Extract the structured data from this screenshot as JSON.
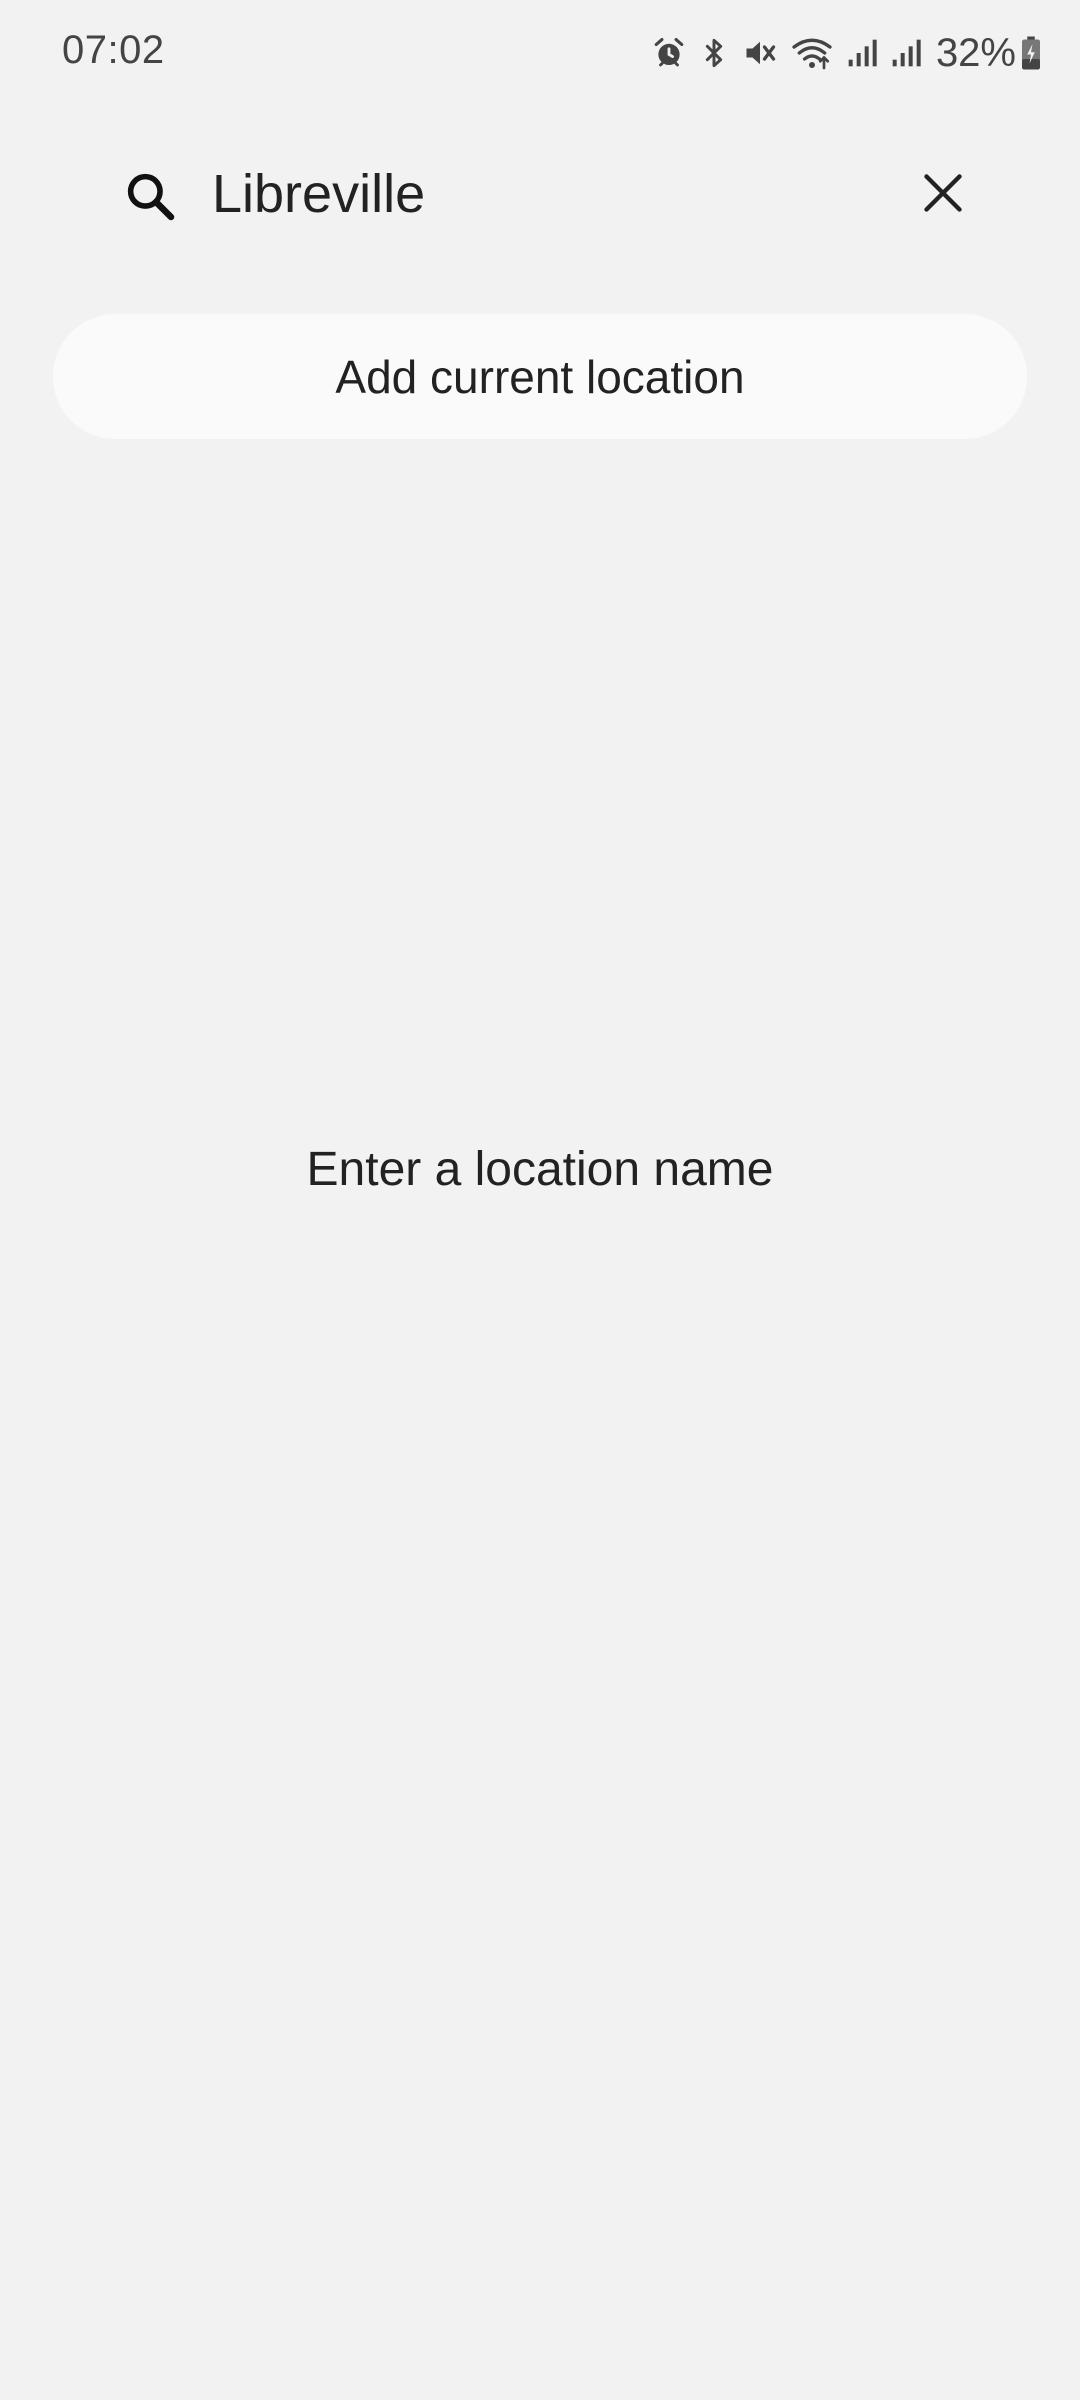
{
  "status_bar": {
    "time": "07:02",
    "battery": "32%",
    "icons": [
      "alarm-icon",
      "bluetooth-icon",
      "mute-icon",
      "wifi-icon",
      "signal-icon",
      "signal-icon",
      "battery-charging-icon"
    ]
  },
  "search": {
    "value": "Libreville",
    "icon": "search-icon",
    "clear_icon": "close-icon"
  },
  "add_current_location": {
    "label": "Add current location"
  },
  "empty_state": {
    "message": "Enter a location name"
  },
  "colors": {
    "background": "#f2f2f2",
    "button_background": "#fafafa",
    "text": "#222222",
    "status_text": "#444444"
  }
}
